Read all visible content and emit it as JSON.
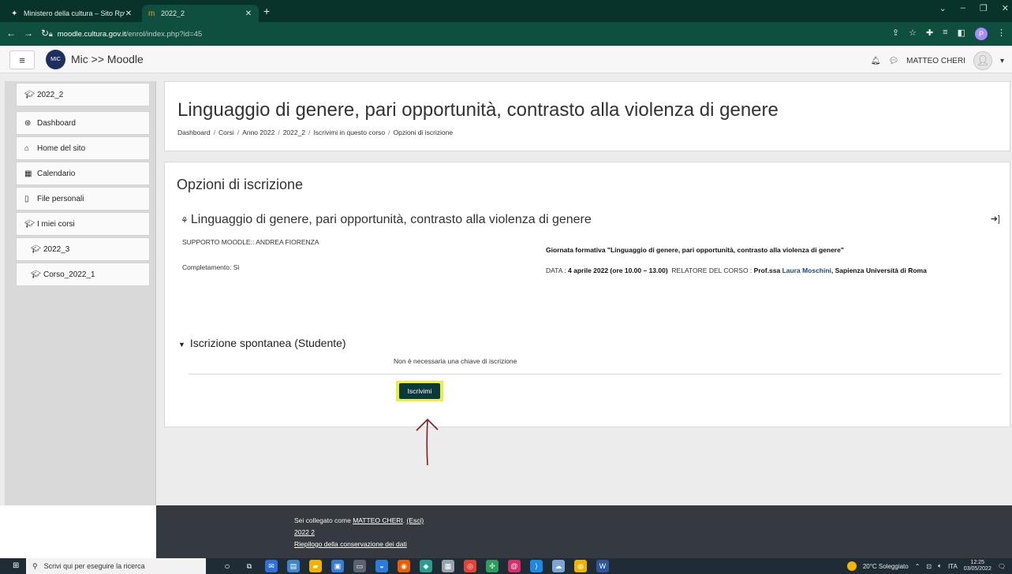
{
  "browser": {
    "tabs": [
      {
        "label": "Ministero della cultura – Sito Rpv",
        "icon": "ministry-favicon"
      },
      {
        "label": "2022_2",
        "icon": "moodle-favicon"
      }
    ],
    "new_tab": "+",
    "url_host": "moodle.cultura.gov.it",
    "url_path": "/enrol/index.php?id=45",
    "profile_initial": "P"
  },
  "moodle_nav": {
    "brand": "Mic >> Moodle",
    "logo_text": "MIC",
    "user": "MATTEO CHERI"
  },
  "sidebar": {
    "items": [
      {
        "label": "2022_2",
        "icon": "graduation-cap-icon"
      },
      {
        "label": "Dashboard",
        "icon": "dashboard-icon"
      },
      {
        "label": "Home del sito",
        "icon": "home-icon"
      },
      {
        "label": "Calendario",
        "icon": "calendar-icon"
      },
      {
        "label": "File personali",
        "icon": "file-icon"
      },
      {
        "label": "I miei corsi",
        "icon": "graduation-cap-icon"
      },
      {
        "label": "2022_3",
        "icon": "graduation-cap-icon"
      },
      {
        "label": "Corso_2022_1",
        "icon": "graduation-cap-icon"
      }
    ]
  },
  "header": {
    "title": "Linguaggio di genere, pari opportunità, contrasto alla violenza di genere",
    "breadcrumb": [
      "Dashboard",
      "Corsi",
      "Anno 2022",
      "2022_2",
      "Iscrivimi in questo corso",
      "Opzioni di iscrizione"
    ]
  },
  "main": {
    "heading": "Opzioni di iscrizione",
    "course_name": "Linguaggio di genere, pari opportunità, contrasto alla violenza di genere",
    "contact": "SUPPORTO MOODLE:: ANDREA FIORENZA",
    "completion": "Completamento: Sì",
    "summary_title": "Giornata formativa \"Linguaggio di genere, pari opportunità, contrasto alla violenza di genere\"",
    "summary_date_label": "DATA : ",
    "summary_date": "4 aprile 2022 (ore 10.00 – 13.00)",
    "summary_speaker_label": "RELATORE DEL CORSO : ",
    "summary_speaker_prefix": "Prof.ssa ",
    "summary_speaker_name": "Laura Moschini",
    "summary_speaker_affil": ", Sapienza Università di Roma",
    "enrol_section": "Iscrizione spontanea (Studente)",
    "no_key": "Non è necessaria una chiave di iscrizione",
    "enrol_button": "Iscrivimi"
  },
  "footer": {
    "logged_prefix": "Sei collegato come ",
    "logged_user": "MATTEO CHERI",
    "logout": "(Esci)",
    "course_link": "2022 2",
    "retention": "Riepilogo della conservazione dei dati"
  },
  "taskbar": {
    "search_placeholder": "Scrivi qui per eseguire la ricerca",
    "weather": "20°C Soleggiato",
    "lang": "ITA",
    "time": "12:25",
    "date": "03/05/2022"
  },
  "colors": {
    "browser_dark": "#07332a",
    "browser_tab": "#0f4f3f",
    "highlight": "#e9ef3c",
    "button": "#0a3a3a",
    "arrow": "#8b1a1a",
    "footer": "#343a40"
  }
}
